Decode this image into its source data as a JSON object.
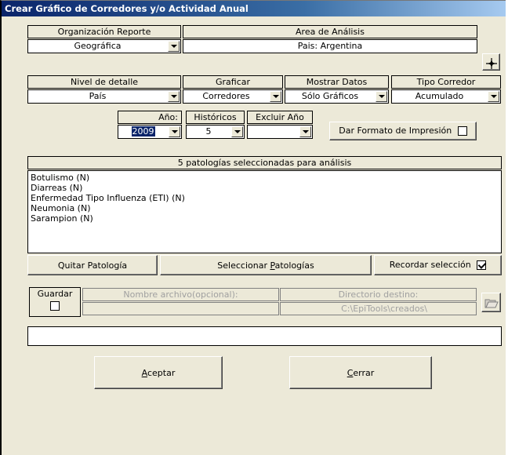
{
  "window": {
    "title": "Crear Gráfico de Corredores y/o Actividad Anual"
  },
  "organizacion": {
    "label": "Organización Reporte",
    "value": "Geográfica"
  },
  "area": {
    "label": "Area de Análisis",
    "value": "Pais: Argentina"
  },
  "nivel": {
    "label": "Nivel de detalle",
    "value": "País"
  },
  "graficar": {
    "label": "Graficar",
    "value": "Corredores"
  },
  "mostrar": {
    "label": "Mostrar Datos",
    "value": "Sólo Gráficos"
  },
  "tipo": {
    "label": "Tipo Corredor",
    "value": "Acumulado"
  },
  "anio": {
    "label": "Año:",
    "value": "2009"
  },
  "historicos": {
    "label": "Históricos",
    "value": "5"
  },
  "excluir": {
    "label": "Excluir Año",
    "value": ""
  },
  "formato": {
    "label": "Dar Formato de Impresión",
    "checked": false
  },
  "patologias": {
    "header": "5 patologías seleccionadas para análisis",
    "items": [
      "Botulismo (N)",
      "Diarreas  (N)",
      "Enfermedad Tipo Influenza (ETI) (N)",
      "Neumonia (N)",
      "Sarampion (N)"
    ]
  },
  "buttons": {
    "quitar": "Quitar Patología",
    "seleccionar_pre": "Seleccionar ",
    "seleccionar_key": "P",
    "seleccionar_post": "atologías",
    "recordar": "Recordar selección",
    "aceptar_key": "A",
    "aceptar_rest": "ceptar",
    "cerrar_key": "C",
    "cerrar_rest": "errar"
  },
  "recordar_checked": true,
  "guardar": {
    "label": "Guardar",
    "checked": false,
    "nombre_label": "Nombre archivo(opcional):",
    "nombre_value": "",
    "dir_label": "Directorio destino:",
    "dir_value": "C:\\EpiTools\\creados\\"
  },
  "status": {
    "value": ""
  },
  "icons": {
    "area_picker": "crosshair-icon",
    "folder": "folder-open-icon"
  }
}
